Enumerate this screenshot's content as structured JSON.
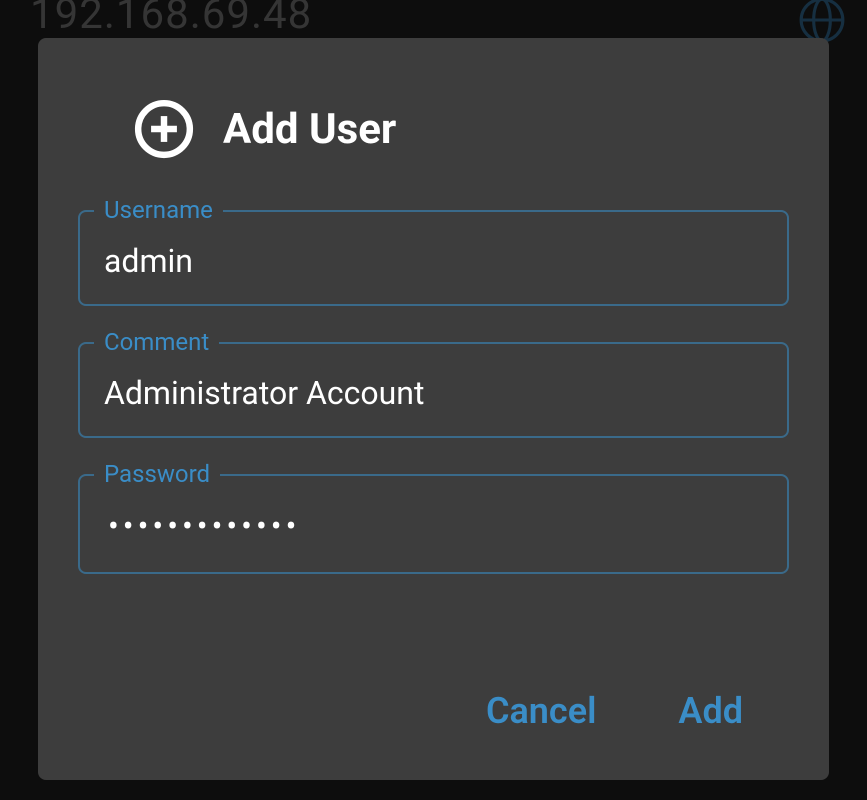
{
  "background": {
    "ip_text": "192.168.69.48"
  },
  "dialog": {
    "title": "Add User",
    "fields": {
      "username": {
        "label": "Username",
        "value": "admin"
      },
      "comment": {
        "label": "Comment",
        "value": "Administrator Account"
      },
      "password": {
        "label": "Password",
        "masked_display": "•••••••••••••"
      }
    },
    "actions": {
      "cancel": "Cancel",
      "add": "Add"
    }
  }
}
